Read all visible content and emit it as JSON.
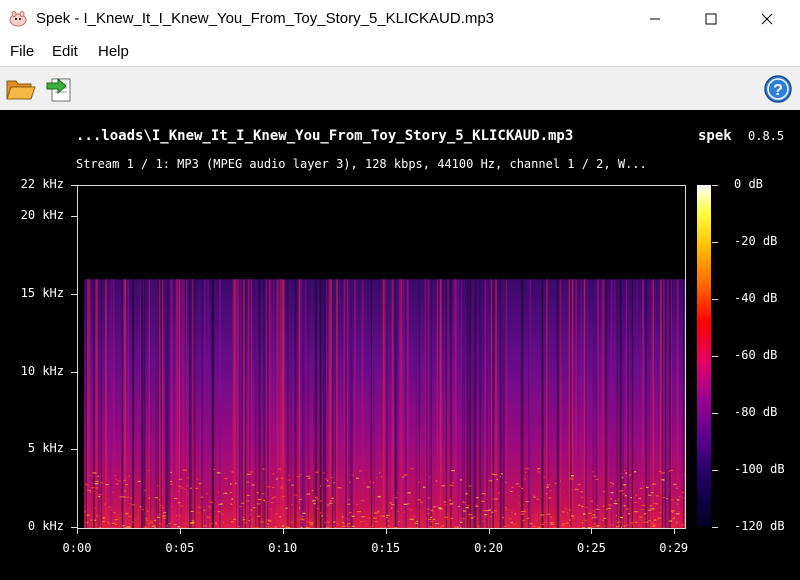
{
  "window": {
    "title": "Spek - I_Knew_It_I_Knew_You_From_Toy_Story_5_KLICKAUD.mp3",
    "controls": [
      "minimize-icon",
      "maximize-icon",
      "close-icon"
    ]
  },
  "menu": {
    "items": [
      {
        "label": "File"
      },
      {
        "label": "Edit"
      },
      {
        "label": "Help"
      }
    ]
  },
  "toolbar": {
    "open_icon": "folder-open-icon",
    "save_icon": "save-arrow-icon",
    "help_icon": "help-icon",
    "help_label": "?"
  },
  "spectrogram": {
    "file_title": "...loads\\I_Knew_It_I_Knew_You_From_Toy_Story_5_KLICKAUD.mp3",
    "app_name": "spek",
    "version": "0.8.5",
    "stream_info": "Stream 1 / 1: MP3 (MPEG audio layer 3), 128 kbps, 44100 Hz, channel 1 / 2, W..."
  },
  "chart_data": {
    "type": "heatmap",
    "x_unit": "seconds",
    "y_unit": "kHz",
    "x_range": [
      0,
      29.5
    ],
    "y_range": [
      0,
      22
    ],
    "content_x_range": [
      0.3,
      29.5
    ],
    "content_y_range": [
      0,
      16
    ],
    "y_ticks": [
      {
        "value": 0,
        "label": "0 kHz"
      },
      {
        "value": 5,
        "label": "5 kHz"
      },
      {
        "value": 10,
        "label": "10 kHz"
      },
      {
        "value": 15,
        "label": "15 kHz"
      },
      {
        "value": 20,
        "label": "20 kHz"
      },
      {
        "value": 22,
        "label": "22 kHz"
      }
    ],
    "x_ticks": [
      {
        "value": 0,
        "label": "0:00"
      },
      {
        "value": 5,
        "label": "0:05"
      },
      {
        "value": 10,
        "label": "0:10"
      },
      {
        "value": 15,
        "label": "0:15"
      },
      {
        "value": 20,
        "label": "0:20"
      },
      {
        "value": 25,
        "label": "0:25"
      },
      {
        "value": 29,
        "label": "0:29"
      }
    ],
    "db_range": [
      -120,
      0
    ],
    "db_ticks": [
      {
        "value": 0,
        "label": "0 dB"
      },
      {
        "value": -20,
        "label": "-20 dB"
      },
      {
        "value": -40,
        "label": "-40 dB"
      },
      {
        "value": -60,
        "label": "-60 dB"
      },
      {
        "value": -80,
        "label": "-80 dB"
      },
      {
        "value": -100,
        "label": "-100 dB"
      },
      {
        "value": -120,
        "label": "-120 dB"
      }
    ]
  }
}
